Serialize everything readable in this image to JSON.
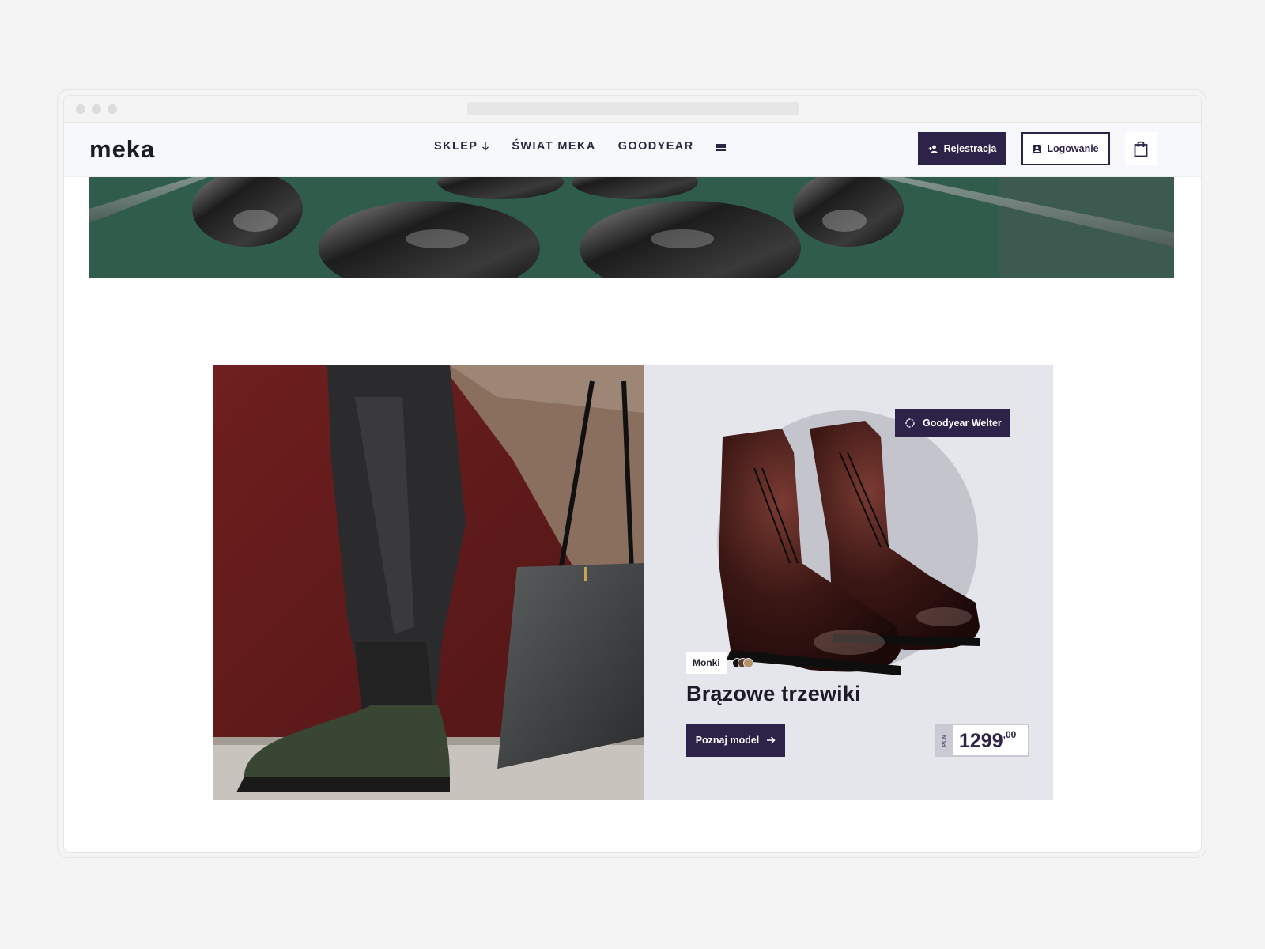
{
  "brand": {
    "logo": "meka"
  },
  "nav": {
    "items": [
      {
        "label": "SKLEP",
        "has_arrow": true
      },
      {
        "label": "ŚWIAT MEKA"
      },
      {
        "label": "GOODYEAR"
      }
    ],
    "menu_icon": "hamburger-icon"
  },
  "header_actions": {
    "register_label": "Rejestracja",
    "register_icon": "add-user-icon",
    "login_label": "Logowanie",
    "login_icon": "user-card-icon",
    "cart_icon": "shopping-bag-icon"
  },
  "promo": {
    "badge_label": "Goodyear Welter",
    "badge_icon": "seal-icon",
    "brand_tag": "Monki",
    "swatches": [
      "#111111",
      "#5b3a2c",
      "#b8926a"
    ],
    "product_name": "Brązowe trzewiki",
    "cta_label": "Poznaj model",
    "cta_icon": "arrow-right-icon",
    "price": {
      "currency": "PLN",
      "integer": "1299",
      "decimal": ",00"
    }
  },
  "colors": {
    "accent": "#2d2247",
    "hero_green": "#2f5c4b",
    "card_bg": "#e5e6eb",
    "photo_wall": "#6a1e1e"
  }
}
